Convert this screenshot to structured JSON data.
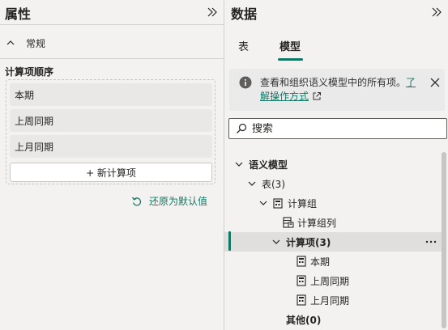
{
  "properties_pane": {
    "title": "属性",
    "section": {
      "label": "常规",
      "expanded": true
    },
    "order_label": "计算项顺序",
    "calc_items": [
      "本期",
      "上周同期",
      "上月同期"
    ],
    "add_button": "+ 新计算项",
    "reset_link": "还原为默认值"
  },
  "data_pane": {
    "title": "数据",
    "tabs": [
      {
        "label": "表",
        "active": false
      },
      {
        "label": "模型",
        "active": true
      }
    ],
    "info": {
      "text": "查看和组织语义模型中的所有项。",
      "link": "了解操作方式"
    },
    "search": {
      "placeholder": "搜索"
    },
    "tree": {
      "semantic_model": "语义模型",
      "tables": "表(3)",
      "calc_group": "计算组",
      "calc_group_column": "计算组列",
      "calc_items": "计算项(3)",
      "items": [
        "本期",
        "上周同期",
        "上月同期"
      ],
      "other": "其他(0)"
    }
  },
  "colors": {
    "accent": "#117865",
    "pane_bg": "#f3f2f1",
    "selected_row": "#e1dfdd"
  },
  "icons": [
    "chevrons-right-icon",
    "chevron-up-icon",
    "undo-icon",
    "info-icon",
    "close-icon",
    "external-link-icon",
    "search-icon",
    "chevron-down-icon",
    "calculation-group-icon",
    "calculation-column-icon",
    "calculation-item-icon",
    "more-options-icon"
  ]
}
